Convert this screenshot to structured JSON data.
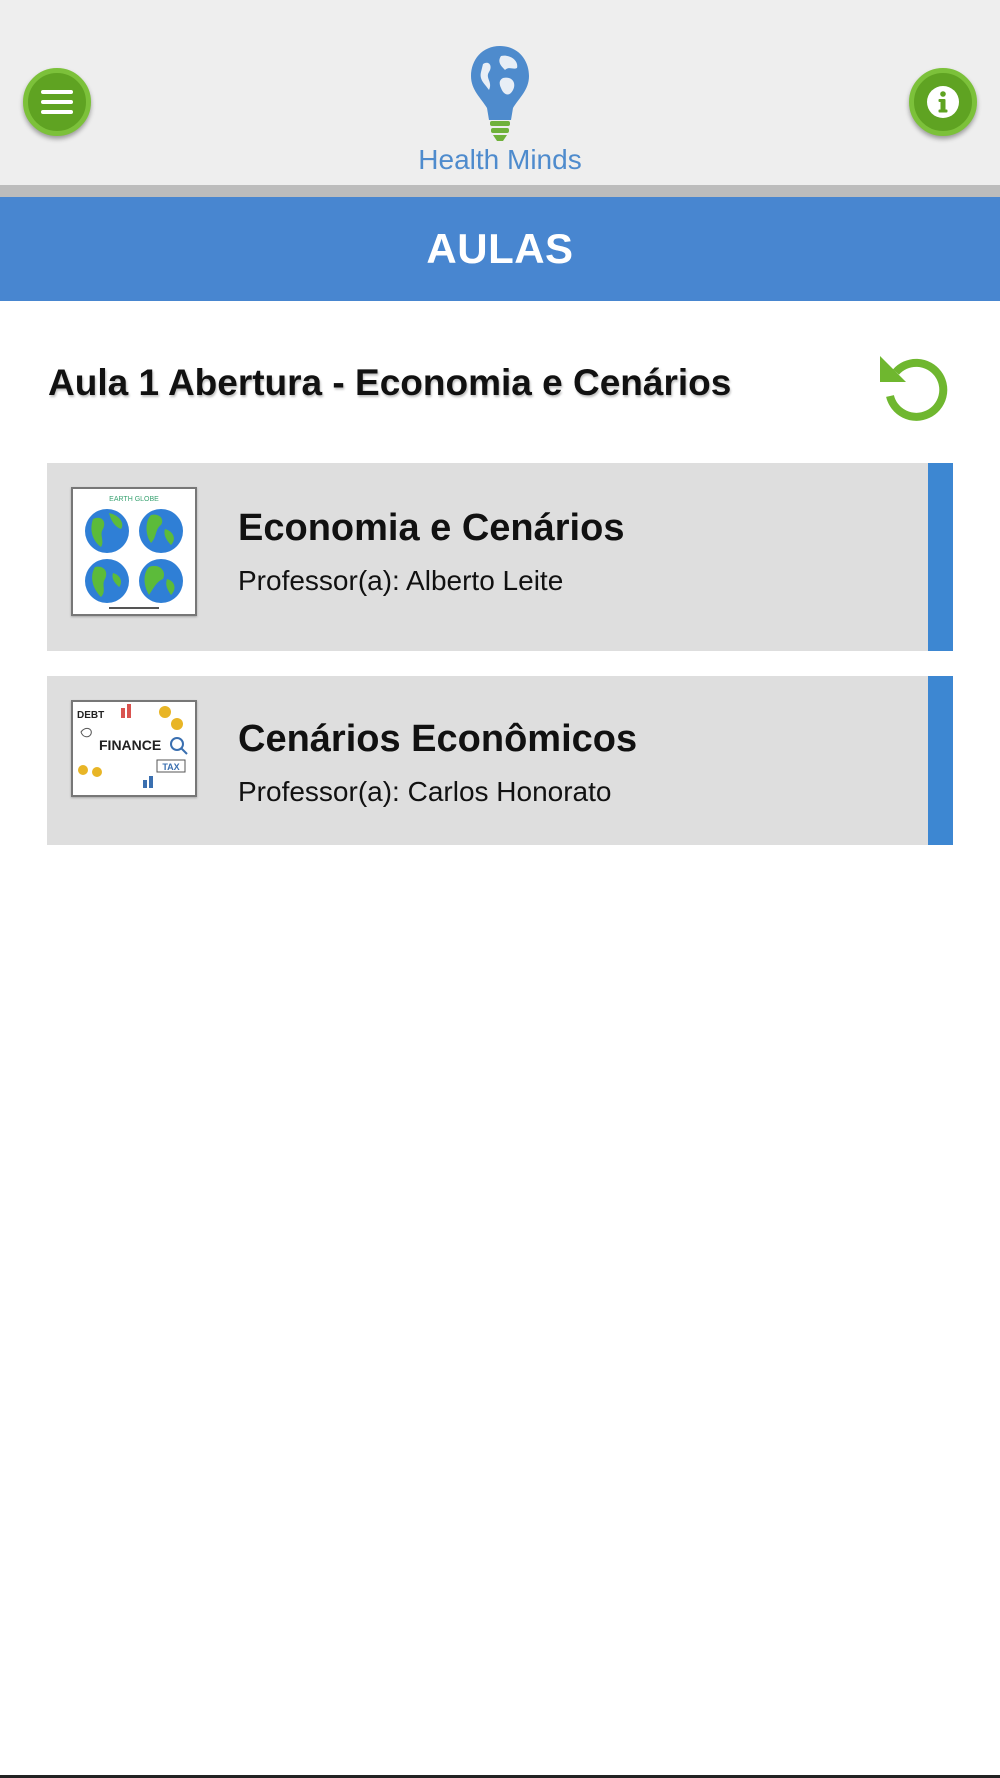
{
  "app": {
    "name": "Health Minds",
    "colors": {
      "accent": "#4886d0",
      "brand_green": "#5fa322",
      "card_bg": "#dedede",
      "card_accent": "#3d87d2"
    }
  },
  "header": {
    "menu_icon": "hamburger-menu-icon",
    "info_icon": "info-icon",
    "logo_icon": "globe-lightbulb-icon",
    "logo_text": "Health Minds"
  },
  "title_bar": {
    "title": "AULAS"
  },
  "lesson": {
    "heading": "Aula 1 Abertura - Economia e Cenários",
    "refresh_icon": "refresh-icon"
  },
  "classes": [
    {
      "title": "Economia e Cenários",
      "professor": "Professor(a): Alberto Leite",
      "thumbnail": "earth-globes-thumbnail",
      "thumb_caption": "EARTH GLOBE"
    },
    {
      "title": "Cenários Econômicos",
      "professor": "Professor(a): Carlos Honorato",
      "thumbnail": "finance-doodles-thumbnail",
      "thumb_words": [
        "DEBT",
        "FINANCE",
        "TAX"
      ]
    }
  ]
}
